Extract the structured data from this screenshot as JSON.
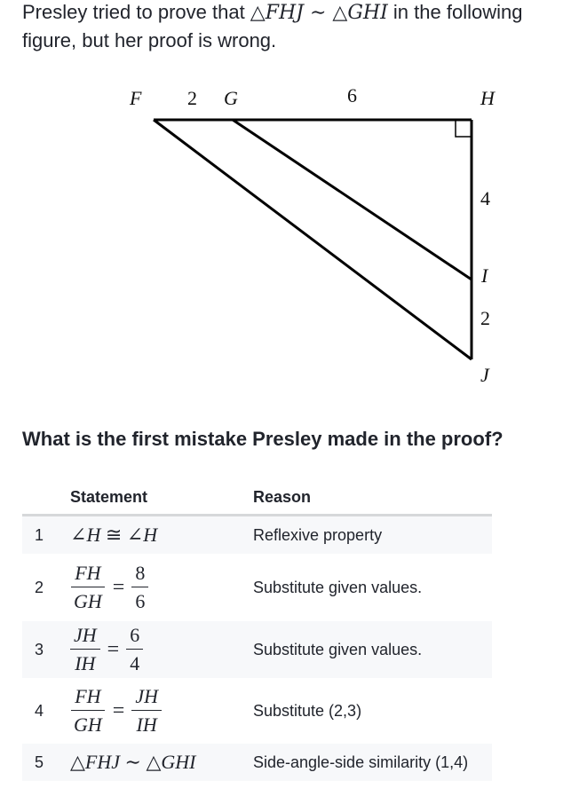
{
  "intro": {
    "prefix": "Presley tried to prove that ",
    "claim_left_tri": "△",
    "claim_left": "FHJ",
    "claim_sim": " ∼ ",
    "claim_right_tri": "△",
    "claim_right": "GHI",
    "suffix": " in the following figure, but her proof is wrong."
  },
  "figure": {
    "points": {
      "F": "F",
      "G": "G",
      "H": "H",
      "I": "I",
      "J": "J"
    },
    "segment_labels": {
      "FG": "2",
      "GH": "6",
      "HI": "4",
      "IJ": "2"
    },
    "right_angle_at": "H"
  },
  "question": "What is the first mistake Presley made in the proof?",
  "proof": {
    "headers": {
      "statement": "Statement",
      "reason": "Reason"
    },
    "rows": [
      {
        "index": "1",
        "statement": {
          "a": "∠",
          "b": "H",
          "c": " ≅ ",
          "d": "∠",
          "e": "H"
        },
        "reason": "Reflexive property"
      },
      {
        "index": "2",
        "statement": {
          "num1": "FH",
          "den1": "GH",
          "eq": "=",
          "num2": "8",
          "den2": "6"
        },
        "reason": "Substitute given values."
      },
      {
        "index": "3",
        "statement": {
          "num1": "JH",
          "den1": "IH",
          "eq": "=",
          "num2": "6",
          "den2": "4"
        },
        "reason": "Substitute given values."
      },
      {
        "index": "4",
        "statement": {
          "num1": "FH",
          "den1": "GH",
          "eq": "=",
          "num2": "JH",
          "den2": "IH"
        },
        "reason": "Substitute (2,3)"
      },
      {
        "index": "5",
        "statement": {
          "t1": "△",
          "a": "FHJ",
          "sim": " ∼ ",
          "t2": "△",
          "b": "GHI"
        },
        "reason": "Side-angle-side similarity (1,4)"
      }
    ]
  }
}
